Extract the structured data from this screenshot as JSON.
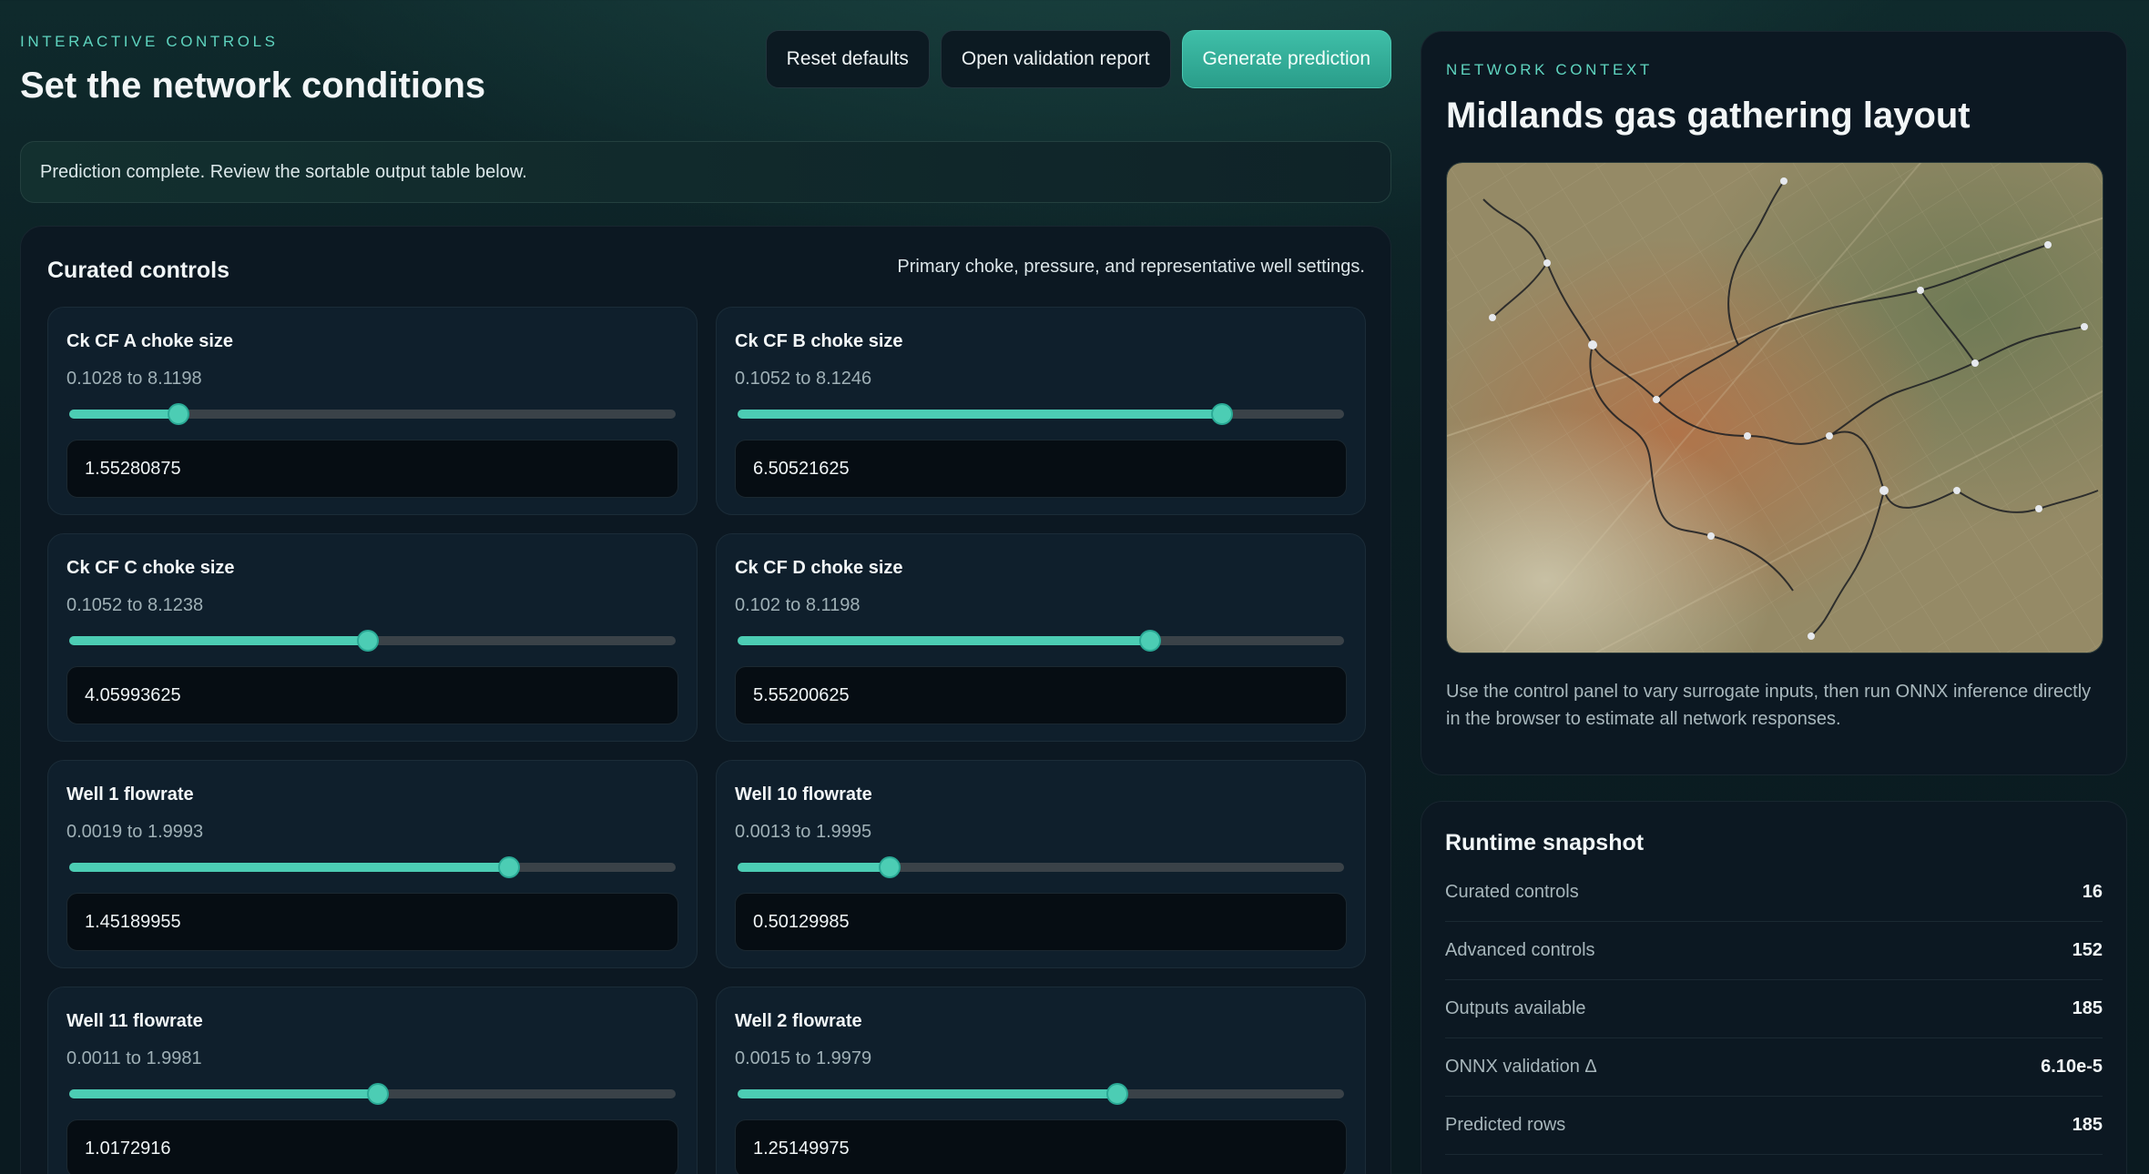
{
  "header": {
    "eyebrow": "INTERACTIVE CONTROLS",
    "title": "Set the network conditions",
    "actions": {
      "reset": "Reset defaults",
      "validation": "Open validation report",
      "generate": "Generate prediction"
    }
  },
  "banner": "Prediction complete. Review the sortable output table below.",
  "controls": {
    "title": "Curated controls",
    "subtitle": "Primary choke, pressure, and representative well settings.",
    "items": [
      {
        "label": "Ck CF A choke size",
        "range": "0.1028 to 8.1198",
        "value": "1.55280875",
        "min": 0.1028,
        "max": 8.1198,
        "num": 1.55280875
      },
      {
        "label": "Ck CF B choke size",
        "range": "0.1052 to 8.1246",
        "value": "6.50521625",
        "min": 0.1052,
        "max": 8.1246,
        "num": 6.50521625
      },
      {
        "label": "Ck CF C choke size",
        "range": "0.1052 to 8.1238",
        "value": "4.05993625",
        "min": 0.1052,
        "max": 8.1238,
        "num": 4.05993625
      },
      {
        "label": "Ck CF D choke size",
        "range": "0.102 to 8.1198",
        "value": "5.55200625",
        "min": 0.102,
        "max": 8.1198,
        "num": 5.55200625
      },
      {
        "label": "Well 1 flowrate",
        "range": "0.0019 to 1.9993",
        "value": "1.45189955",
        "min": 0.0019,
        "max": 1.9993,
        "num": 1.45189955
      },
      {
        "label": "Well 10 flowrate",
        "range": "0.0013 to 1.9995",
        "value": "0.50129985",
        "min": 0.0013,
        "max": 1.9995,
        "num": 0.50129985
      },
      {
        "label": "Well 11 flowrate",
        "range": "0.0011 to 1.9981",
        "value": "1.0172916",
        "min": 0.0011,
        "max": 1.9981,
        "num": 1.0172916
      },
      {
        "label": "Well 2 flowrate",
        "range": "0.0015 to 1.9979",
        "value": "1.25149975",
        "min": 0.0015,
        "max": 1.9979,
        "num": 1.25149975
      }
    ]
  },
  "context": {
    "eyebrow": "NETWORK CONTEXT",
    "title": "Midlands gas gathering layout",
    "description": "Use the control panel to vary surrogate inputs, then run ONNX inference directly in the browser to estimate all network responses."
  },
  "snapshot": {
    "title": "Runtime snapshot",
    "rows": [
      {
        "key": "Curated controls",
        "value": "16"
      },
      {
        "key": "Advanced controls",
        "value": "152"
      },
      {
        "key": "Outputs available",
        "value": "185"
      },
      {
        "key": "ONNX validation Δ",
        "value": "6.10e-5"
      },
      {
        "key": "Predicted rows",
        "value": "185"
      }
    ]
  },
  "colors": {
    "accent": "#4ccdb4",
    "primary_button": "#2a9d8a",
    "panel": "#0c1822",
    "card": "#0f1f2c"
  }
}
